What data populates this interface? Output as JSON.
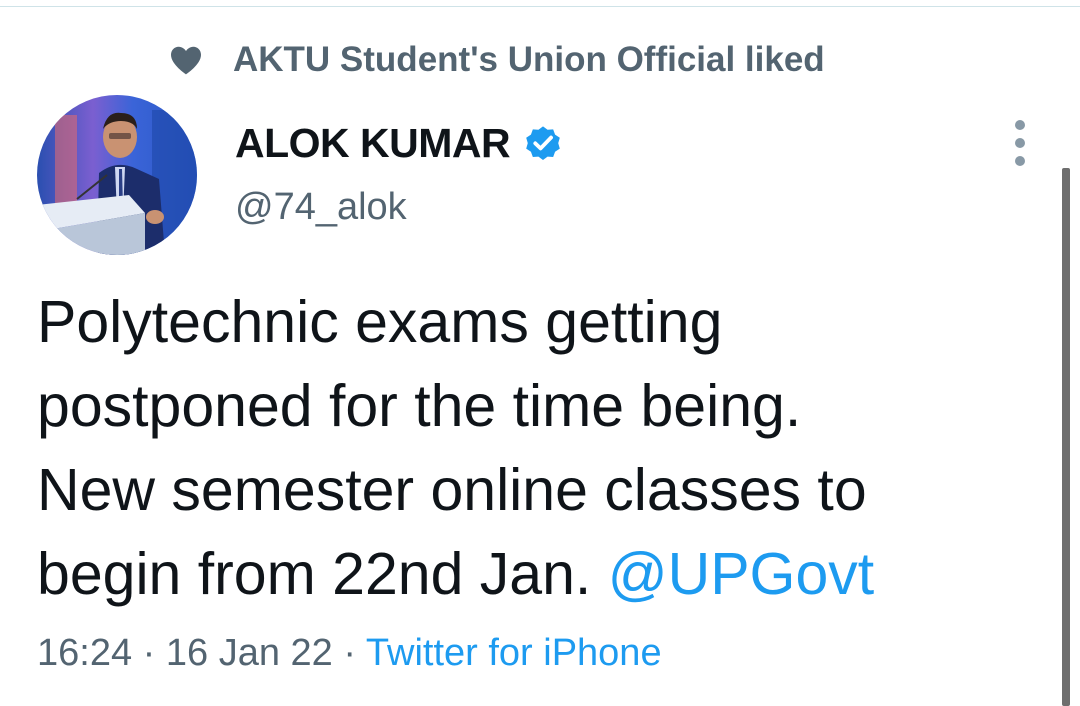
{
  "social_context": {
    "icon": "heart-icon",
    "text": "AKTU Student's Union Official liked"
  },
  "author": {
    "name": "ALOK KUMAR",
    "verified_icon": "verified-badge-icon",
    "handle": "@74_alok"
  },
  "tweet": {
    "lines": [
      "Polytechnic exams getting",
      "postponed for the time being.",
      "New semester online classes to",
      "begin from 22nd Jan. "
    ],
    "mention": "@UPGovt"
  },
  "meta": {
    "time": "16:24",
    "separator_1": " · ",
    "date": "16 Jan 22",
    "separator_2": " · ",
    "source": "Twitter for iPhone"
  },
  "colors": {
    "link": "#1d9bf0",
    "secondary_text": "#536471",
    "primary_text": "#0f1419"
  }
}
